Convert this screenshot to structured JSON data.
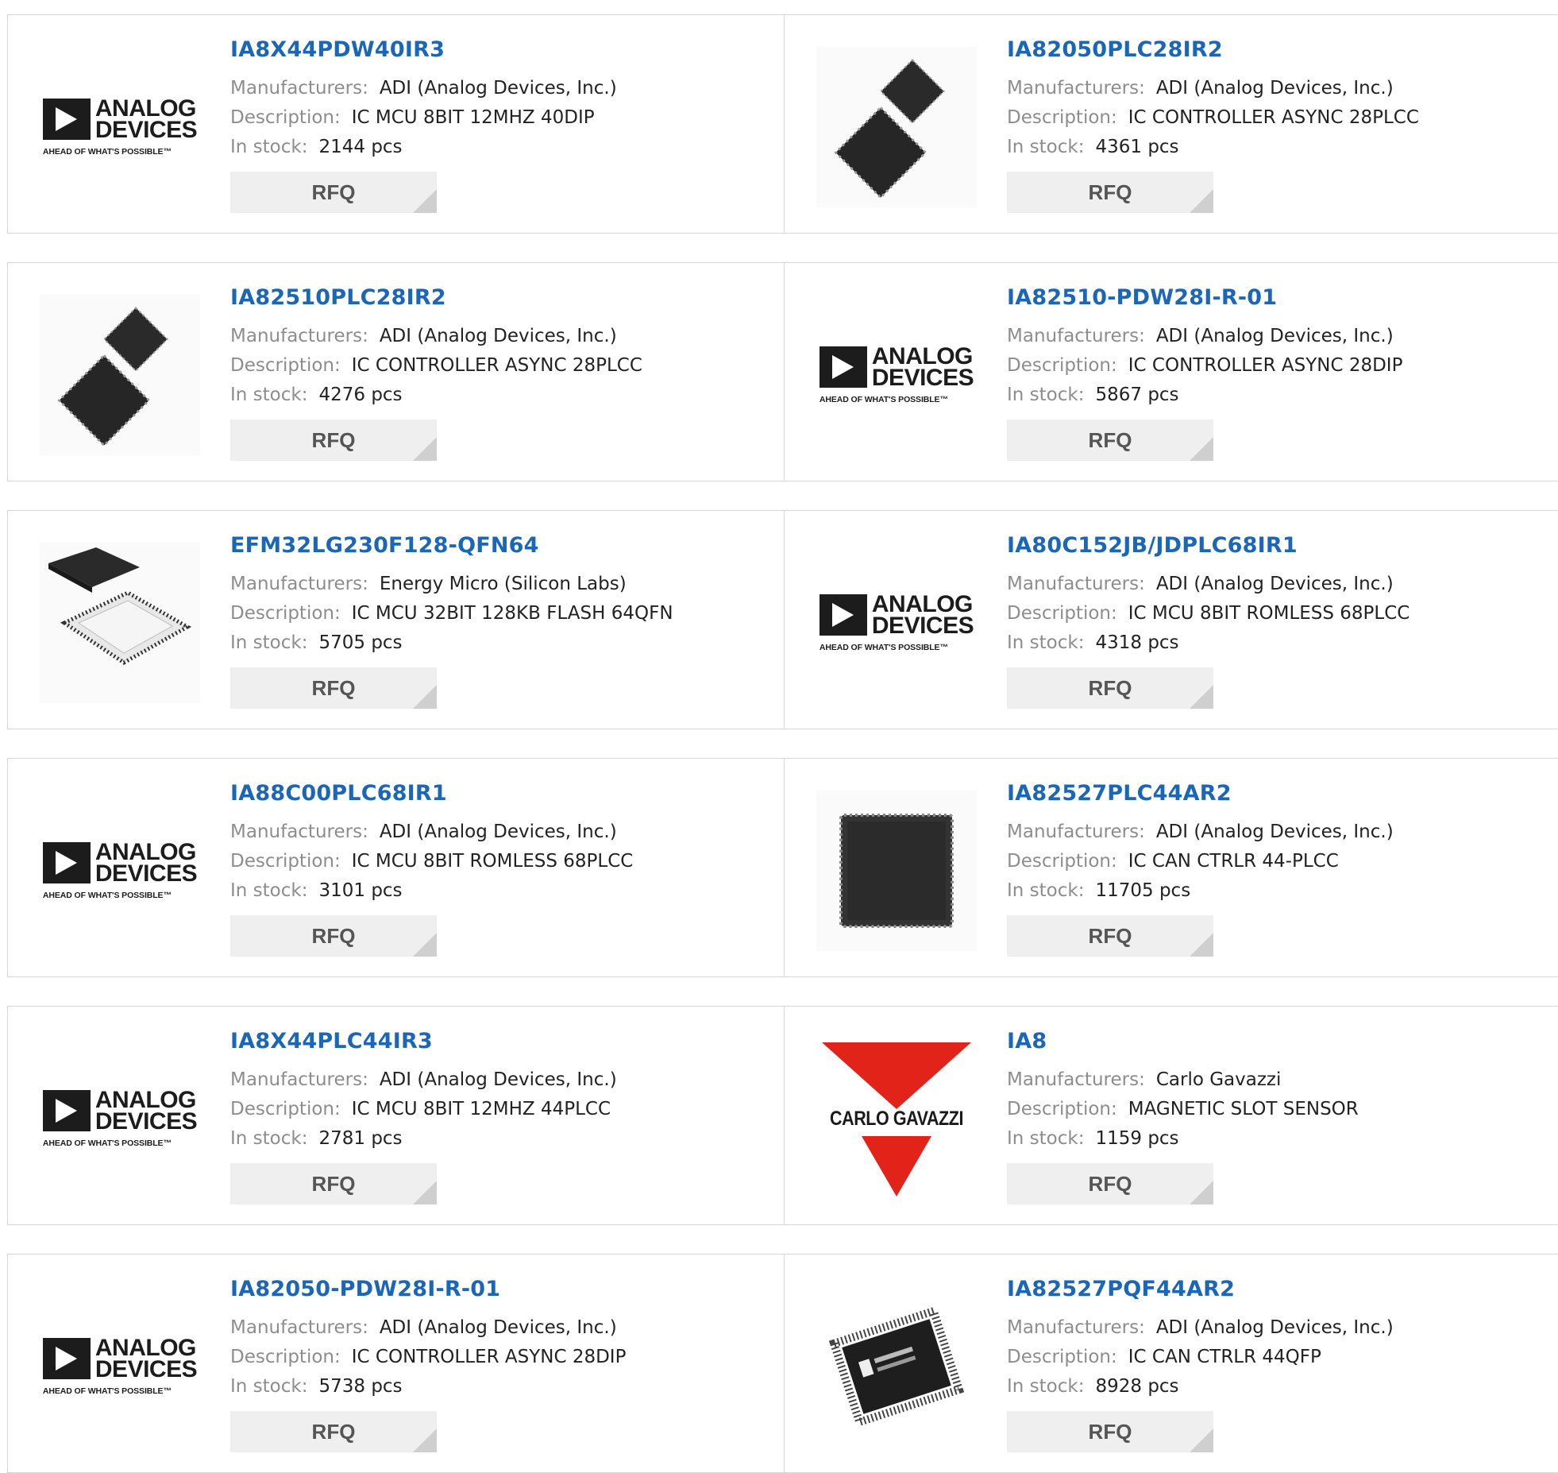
{
  "labels": {
    "manufacturers": "Manufacturers:",
    "description": "Description:",
    "in_stock": "In stock:",
    "rfq": "RFQ"
  },
  "logos": {
    "adi_word1": "ANALOG",
    "adi_word2": "DEVICES",
    "adi_tagline": "AHEAD OF WHAT'S POSSIBLE™",
    "cg_name": "CARLO GAVAZZI"
  },
  "colors": {
    "part_link": "#1a66b8",
    "label_gray": "#8d8d8d",
    "rfq_bg": "#efefef",
    "carlo_gavazzi_red": "#e2231a"
  },
  "products": [
    {
      "part": "IA8X44PDW40IR3",
      "manufacturer": "ADI (Analog Devices, Inc.)",
      "description": "IC MCU 8BIT 12MHZ 40DIP",
      "stock": "2144 pcs",
      "image": "adi-logo"
    },
    {
      "part": "IA82050PLC28IR2",
      "manufacturer": "ADI (Analog Devices, Inc.)",
      "description": "IC CONTROLLER ASYNC 28PLCC",
      "stock": "4361 pcs",
      "image": "plcc-chip-pair"
    },
    {
      "part": "IA82510PLC28IR2",
      "manufacturer": "ADI (Analog Devices, Inc.)",
      "description": "IC CONTROLLER ASYNC 28PLCC",
      "stock": "4276 pcs",
      "image": "plcc-chip-pair"
    },
    {
      "part": "IA82510-PDW28I-R-01",
      "manufacturer": "ADI (Analog Devices, Inc.)",
      "description": "IC CONTROLLER ASYNC 28DIP",
      "stock": "5867 pcs",
      "image": "adi-logo"
    },
    {
      "part": "EFM32LG230F128-QFN64",
      "manufacturer": "Energy Micro (Silicon Labs)",
      "description": "IC MCU 32BIT 128KB FLASH 64QFN",
      "stock": "5705 pcs",
      "image": "qfn-chip"
    },
    {
      "part": "IA80C152JB/JDPLC68IR1",
      "manufacturer": "ADI (Analog Devices, Inc.)",
      "description": "IC MCU 8BIT ROMLESS 68PLCC",
      "stock": "4318 pcs",
      "image": "adi-logo"
    },
    {
      "part": "IA88C00PLC68IR1",
      "manufacturer": "ADI (Analog Devices, Inc.)",
      "description": "IC MCU 8BIT ROMLESS 68PLCC",
      "stock": "3101 pcs",
      "image": "adi-logo"
    },
    {
      "part": "IA82527PLC44AR2",
      "manufacturer": "ADI (Analog Devices, Inc.)",
      "description": "IC CAN CTRLR 44-PLCC",
      "stock": "11705 pcs",
      "image": "plcc44-chip"
    },
    {
      "part": "IA8X44PLC44IR3",
      "manufacturer": "ADI (Analog Devices, Inc.)",
      "description": "IC MCU 8BIT 12MHZ 44PLCC",
      "stock": "2781 pcs",
      "image": "adi-logo"
    },
    {
      "part": "IA8",
      "manufacturer": "Carlo Gavazzi",
      "description": "MAGNETIC SLOT SENSOR",
      "stock": "1159 pcs",
      "image": "carlo-gavazzi-logo"
    },
    {
      "part": "IA82050-PDW28I-R-01",
      "manufacturer": "ADI (Analog Devices, Inc.)",
      "description": "IC CONTROLLER ASYNC 28DIP",
      "stock": "5738 pcs",
      "image": "adi-logo"
    },
    {
      "part": "IA82527PQF44AR2",
      "manufacturer": "ADI (Analog Devices, Inc.)",
      "description": "IC CAN CTRLR 44QFP",
      "stock": "8928 pcs",
      "image": "qfp-chip"
    }
  ]
}
